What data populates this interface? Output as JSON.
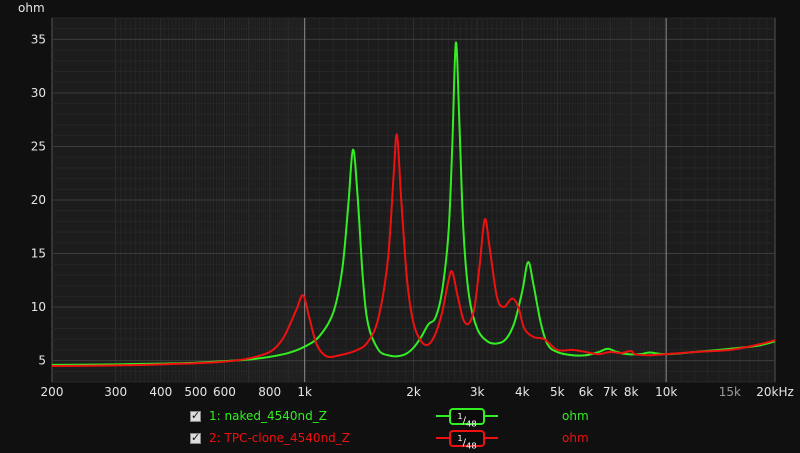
{
  "chart_data": {
    "type": "line",
    "ylabel": "ohm",
    "xscale": "log",
    "xlim": [
      200,
      20000
    ],
    "ylim": [
      3,
      37
    ],
    "grid": true,
    "x_ticks": [
      {
        "v": 200,
        "label": "200"
      },
      {
        "v": 300,
        "label": "300"
      },
      {
        "v": 400,
        "label": "400"
      },
      {
        "v": 500,
        "label": "500"
      },
      {
        "v": 600,
        "label": "600"
      },
      {
        "v": 800,
        "label": "800"
      },
      {
        "v": 1000,
        "label": "1k"
      },
      {
        "v": 2000,
        "label": "2k"
      },
      {
        "v": 3000,
        "label": "3k"
      },
      {
        "v": 4000,
        "label": "4k"
      },
      {
        "v": 5000,
        "label": "5k"
      },
      {
        "v": 6000,
        "label": "6k"
      },
      {
        "v": 7000,
        "label": "7k"
      },
      {
        "v": 8000,
        "label": "8k"
      },
      {
        "v": 10000,
        "label": "10k"
      },
      {
        "v": 15000,
        "label": "15k",
        "dim": true
      },
      {
        "v": 20000,
        "label": "20kHz"
      }
    ],
    "y_ticks": [
      {
        "v": 5,
        "label": "5"
      },
      {
        "v": 10,
        "label": "10"
      },
      {
        "v": 15,
        "label": "15"
      },
      {
        "v": 20,
        "label": "20"
      },
      {
        "v": 25,
        "label": "25"
      },
      {
        "v": 30,
        "label": "30"
      },
      {
        "v": 35,
        "label": "35"
      }
    ],
    "series": [
      {
        "name": "1: naked_4540nd_Z",
        "color": "#33ee22",
        "unit": "ohm",
        "smoothing": "1/48",
        "points": [
          [
            200,
            4.6
          ],
          [
            300,
            4.65
          ],
          [
            400,
            4.72
          ],
          [
            500,
            4.8
          ],
          [
            600,
            4.95
          ],
          [
            700,
            5.1
          ],
          [
            800,
            5.35
          ],
          [
            900,
            5.7
          ],
          [
            1000,
            6.3
          ],
          [
            1100,
            7.3
          ],
          [
            1200,
            9.5
          ],
          [
            1270,
            13.5
          ],
          [
            1320,
            19.5
          ],
          [
            1360,
            24.7
          ],
          [
            1400,
            20.5
          ],
          [
            1450,
            12.5
          ],
          [
            1500,
            8.3
          ],
          [
            1600,
            6.0
          ],
          [
            1700,
            5.5
          ],
          [
            1800,
            5.4
          ],
          [
            1900,
            5.6
          ],
          [
            2000,
            6.2
          ],
          [
            2100,
            7.2
          ],
          [
            2200,
            8.4
          ],
          [
            2300,
            9.0
          ],
          [
            2400,
            11.5
          ],
          [
            2500,
            17.0
          ],
          [
            2560,
            25.0
          ],
          [
            2620,
            34.7
          ],
          [
            2680,
            27.0
          ],
          [
            2750,
            17.0
          ],
          [
            2850,
            11.0
          ],
          [
            3000,
            8.0
          ],
          [
            3200,
            6.8
          ],
          [
            3400,
            6.6
          ],
          [
            3600,
            7.0
          ],
          [
            3800,
            8.5
          ],
          [
            4000,
            11.5
          ],
          [
            4150,
            14.2
          ],
          [
            4300,
            12.0
          ],
          [
            4500,
            8.5
          ],
          [
            4700,
            6.5
          ],
          [
            5000,
            5.8
          ],
          [
            5500,
            5.5
          ],
          [
            6000,
            5.5
          ],
          [
            6500,
            5.8
          ],
          [
            6900,
            6.1
          ],
          [
            7300,
            5.8
          ],
          [
            7800,
            5.6
          ],
          [
            8500,
            5.6
          ],
          [
            9000,
            5.75
          ],
          [
            10000,
            5.6
          ],
          [
            12000,
            5.8
          ],
          [
            15000,
            6.1
          ],
          [
            18000,
            6.4
          ],
          [
            20000,
            6.8
          ]
        ]
      },
      {
        "name": "2: TPC-clone_4540nd_Z",
        "color": "#ee1111",
        "unit": "ohm",
        "smoothing": "1/48",
        "points": [
          [
            200,
            4.5
          ],
          [
            300,
            4.55
          ],
          [
            400,
            4.65
          ],
          [
            500,
            4.75
          ],
          [
            600,
            4.9
          ],
          [
            700,
            5.2
          ],
          [
            800,
            5.8
          ],
          [
            860,
            6.8
          ],
          [
            900,
            8.0
          ],
          [
            950,
            9.8
          ],
          [
            990,
            11.1
          ],
          [
            1030,
            9.0
          ],
          [
            1080,
            6.5
          ],
          [
            1150,
            5.4
          ],
          [
            1250,
            5.5
          ],
          [
            1400,
            6.0
          ],
          [
            1500,
            6.8
          ],
          [
            1600,
            9.0
          ],
          [
            1700,
            14.5
          ],
          [
            1760,
            22.0
          ],
          [
            1800,
            26.1
          ],
          [
            1850,
            20.0
          ],
          [
            1920,
            12.5
          ],
          [
            2000,
            8.5
          ],
          [
            2100,
            6.8
          ],
          [
            2200,
            6.5
          ],
          [
            2300,
            7.5
          ],
          [
            2400,
            9.5
          ],
          [
            2500,
            12.5
          ],
          [
            2560,
            13.3
          ],
          [
            2650,
            11.0
          ],
          [
            2750,
            8.8
          ],
          [
            2850,
            8.5
          ],
          [
            2950,
            10.0
          ],
          [
            3050,
            14.0
          ],
          [
            3150,
            18.2
          ],
          [
            3250,
            15.5
          ],
          [
            3400,
            11.0
          ],
          [
            3550,
            10.0
          ],
          [
            3750,
            10.8
          ],
          [
            3900,
            10.0
          ],
          [
            4050,
            8.0
          ],
          [
            4300,
            7.2
          ],
          [
            4600,
            7.0
          ],
          [
            5000,
            6.0
          ],
          [
            5500,
            6.0
          ],
          [
            6000,
            5.8
          ],
          [
            6500,
            5.6
          ],
          [
            7000,
            5.8
          ],
          [
            7500,
            5.7
          ],
          [
            8000,
            5.9
          ],
          [
            8200,
            5.6
          ],
          [
            9000,
            5.5
          ],
          [
            10000,
            5.6
          ],
          [
            12000,
            5.8
          ],
          [
            15000,
            6.0
          ],
          [
            18000,
            6.5
          ],
          [
            20000,
            6.9
          ]
        ]
      }
    ]
  },
  "legend": [
    {
      "checked": true,
      "name": "1: naked_4540nd_Z",
      "smoothing_num": "1",
      "smoothing_den": "48",
      "unit": "ohm",
      "color": "#33ee22"
    },
    {
      "checked": true,
      "name": "2: TPC-clone_4540nd_Z",
      "smoothing_num": "1",
      "smoothing_den": "48",
      "unit": "ohm",
      "color": "#ee1111"
    }
  ]
}
